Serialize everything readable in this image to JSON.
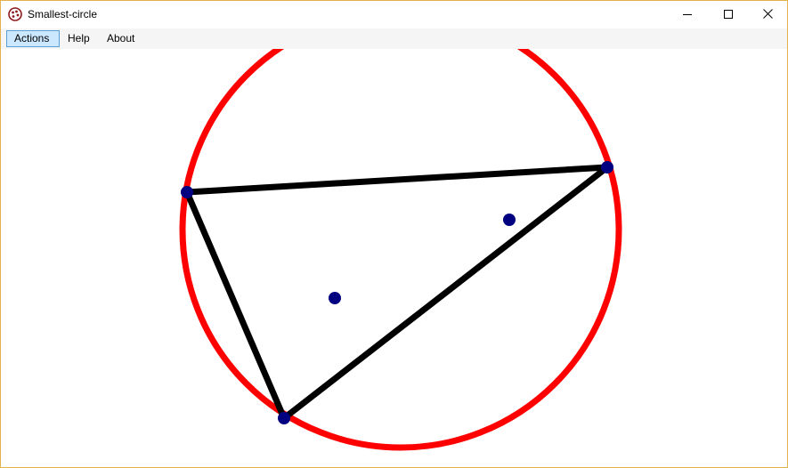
{
  "window": {
    "title": "Smallest-circle",
    "app_icon": "palette-icon",
    "controls": {
      "minimize_icon": "minimize-icon",
      "maximize_icon": "maximize-icon",
      "close_icon": "close-icon"
    }
  },
  "menubar": {
    "items": [
      {
        "label": "Actions",
        "active": true
      },
      {
        "label": "Help",
        "active": false
      },
      {
        "label": "About",
        "active": false
      }
    ]
  },
  "colors": {
    "circle": "#ff0000",
    "triangle": "#000000",
    "points": "#000080",
    "menu_active_bg": "#cce8ff",
    "menu_active_border": "#5a9ed6",
    "window_border": "#e3b24c"
  }
}
